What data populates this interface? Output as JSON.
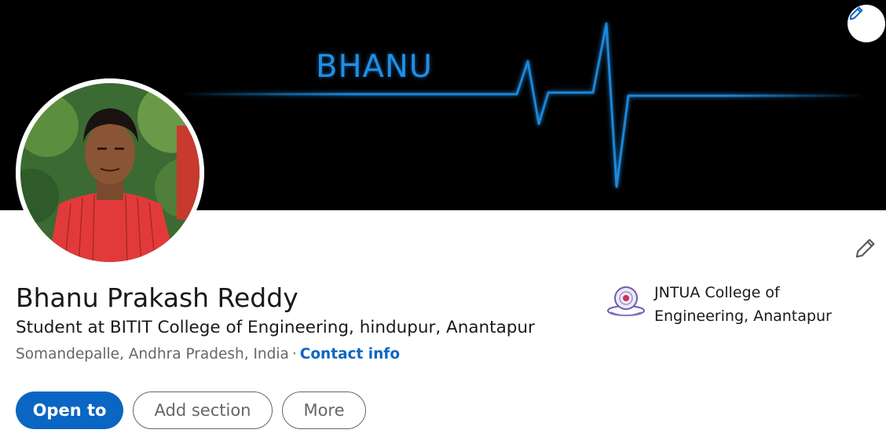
{
  "banner": {
    "text": "BHANU",
    "edit_icon": "pencil-icon",
    "accent_color": "#1e8fe6"
  },
  "profile": {
    "name": "Bhanu Prakash Reddy",
    "headline": "Student at BITIT College of Engineering, hindupur, Anantapur",
    "location": "Somandepalle, Andhra Pradesh, India",
    "separator": "·",
    "contact_info_label": "Contact info",
    "edit_icon": "pencil-icon"
  },
  "education": {
    "school_name": "JNTUA College of Engineering, Anantapur",
    "logo_icon": "university-logo-icon"
  },
  "actions": {
    "open_to_label": "Open to",
    "add_section_label": "Add section",
    "more_label": "More"
  },
  "colors": {
    "primary": "#0a66c2",
    "text": "#191919",
    "muted": "#666666",
    "banner_bg": "#000000"
  }
}
